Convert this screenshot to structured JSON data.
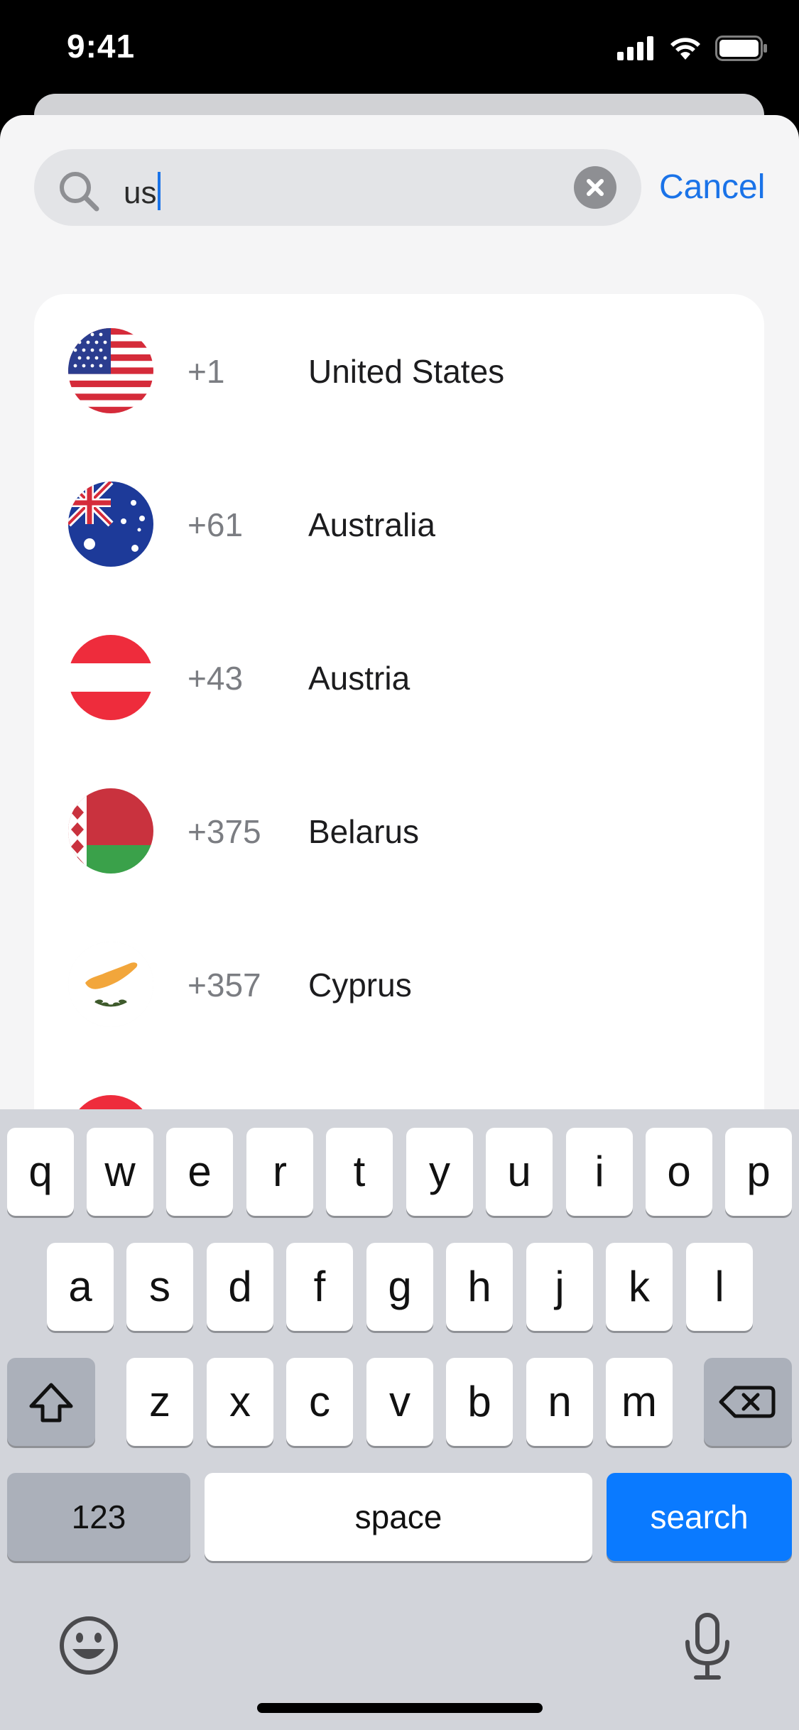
{
  "status_bar": {
    "time": "9:41",
    "icons": [
      "cellular-signal-icon",
      "wifi-icon",
      "battery-icon"
    ]
  },
  "search": {
    "query": "us",
    "cancel_label": "Cancel"
  },
  "results": [
    {
      "code": "+1",
      "name": "United States",
      "flag": "us-flag-icon"
    },
    {
      "code": "+61",
      "name": "Australia",
      "flag": "australia-flag-icon"
    },
    {
      "code": "+43",
      "name": "Austria",
      "flag": "austria-flag-icon"
    },
    {
      "code": "+375",
      "name": "Belarus",
      "flag": "belarus-flag-icon"
    },
    {
      "code": "+357",
      "name": "Cyprus",
      "flag": "cyprus-flag-icon"
    }
  ],
  "keyboard": {
    "row1": [
      "q",
      "w",
      "e",
      "r",
      "t",
      "y",
      "u",
      "i",
      "o",
      "p"
    ],
    "row2": [
      "a",
      "s",
      "d",
      "f",
      "g",
      "h",
      "j",
      "k",
      "l"
    ],
    "row3": [
      "z",
      "x",
      "c",
      "v",
      "b",
      "n",
      "m"
    ],
    "numbers_label": "123",
    "space_label": "space",
    "search_label": "search"
  },
  "colors": {
    "accent": "#1a73e8",
    "search_key": "#0a7aff",
    "keyboard_bg": "#d2d4da"
  }
}
